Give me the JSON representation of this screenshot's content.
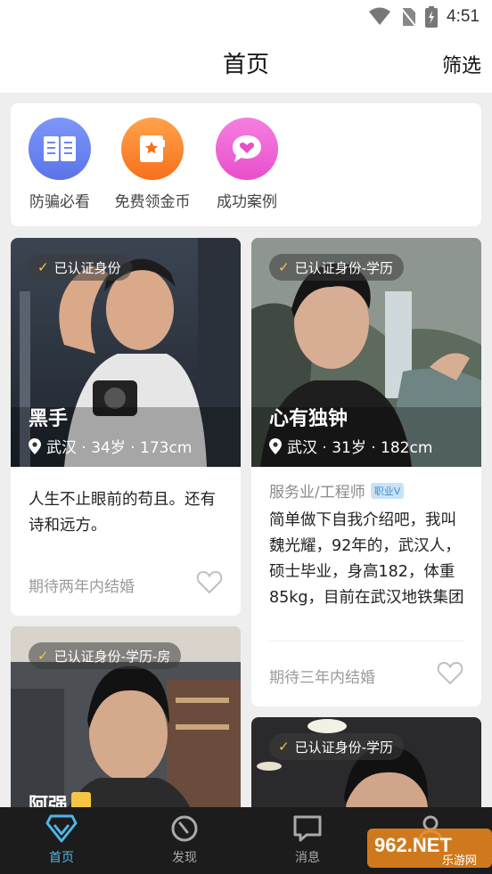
{
  "status": {
    "time": "4:51"
  },
  "header": {
    "title": "首页",
    "filter_label": "筛选"
  },
  "quick_links": [
    {
      "label": "防骗必看",
      "icon": "book-icon",
      "color": "#6f86f0"
    },
    {
      "label": "免费领金币",
      "icon": "coin-book-icon",
      "color": "#fb8a2e"
    },
    {
      "label": "成功案例",
      "icon": "heart-chat-icon",
      "color": "#ee5fd4"
    }
  ],
  "profiles": [
    {
      "badge": "已认证身份",
      "name": "黑手",
      "location": "武汉 · 34岁 · 173cm",
      "bio": "人生不止眼前的苟且。还有诗和远方。",
      "expect": "期待两年内结婚"
    },
    {
      "badge": "已认证身份-学历",
      "name": "心有独钟",
      "location": "武汉 · 31岁 · 182cm",
      "occupation": "服务业/工程师",
      "occupation_badge": "职业V",
      "bio": "简单做下自我介绍吧，我叫魏光耀，92年的，武汉人，硕士毕业，身高182，体重85kg，目前在武汉地铁集团有限公司上班，工...",
      "expect": "期待三年内结婚"
    },
    {
      "badge": "已认证身份-学历-房",
      "name": "阿强"
    },
    {
      "badge": "已认证身份-学历"
    }
  ],
  "tabs": [
    {
      "label": "首页",
      "icon": "diamond-icon",
      "active": true
    },
    {
      "label": "发现",
      "icon": "compass-icon",
      "active": false
    },
    {
      "label": "消息",
      "icon": "message-icon",
      "active": false
    },
    {
      "label": "",
      "icon": "profile-icon",
      "active": false
    }
  ],
  "watermark": {
    "brand": "962.NET",
    "sub": "乐游网"
  },
  "colors": {
    "accent": "#4fb6e6",
    "tab_inactive": "#aaaaaa",
    "badge_check": "#f5c542"
  }
}
